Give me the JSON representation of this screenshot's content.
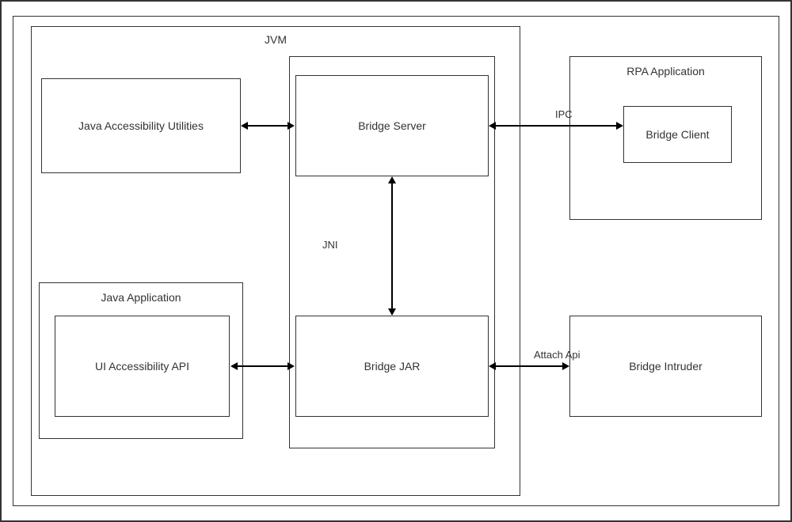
{
  "containers": {
    "jvm": "JVM",
    "rpa_app": "RPA Application",
    "java_app": "Java Application"
  },
  "boxes": {
    "jau": "Java Accessibility Utilities",
    "bridge_server": "Bridge Server",
    "bridge_jar": "Bridge JAR",
    "ui_api": "UI Accessibility API",
    "bridge_client": "Bridge Client",
    "bridge_intruder": "Bridge Intruder"
  },
  "edges": {
    "jni": "JNI",
    "ipc": "IPC",
    "attach_api": "Attach Api"
  }
}
